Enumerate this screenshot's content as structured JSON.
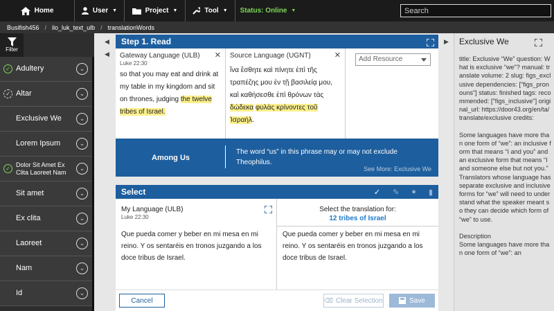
{
  "topbar": {
    "home": "Home",
    "user": "User",
    "project": "Project",
    "tool": "Tool",
    "status": "Status: Online",
    "search_placeholder": "Search"
  },
  "breadcrumb": [
    "Busifish456",
    "ilo_luk_text_ulb",
    "translationWords"
  ],
  "sidebar": {
    "filter_label": "Filter",
    "items": [
      {
        "label": "Adultery",
        "state": "checked"
      },
      {
        "label": "Altar",
        "state": "dashed"
      },
      {
        "label": "Exclusive We",
        "state": "none"
      },
      {
        "label": "Lorem Ipsum",
        "state": "none"
      },
      {
        "label": "Dolor Sit Amet Ex Clita Laoreet Nam",
        "state": "checked"
      },
      {
        "label": "Sit amet",
        "state": "none"
      },
      {
        "label": "Ex clita",
        "state": "none"
      },
      {
        "label": "Laoreet",
        "state": "none"
      },
      {
        "label": "Nam",
        "state": "none"
      },
      {
        "label": "Id",
        "state": "none"
      }
    ]
  },
  "step": {
    "title": "Step 1. Read",
    "gateway": {
      "title": "Gateway Language (ULB)",
      "ref": "Luke 22:30",
      "text_before": "so that you may eat and drink at my table in my kingdom and sit on thrones, judging ",
      "text_highlight": "the twelve tribes of Israel."
    },
    "source": {
      "title": "Source Language (UGNT)",
      "text_before": "ἵνα ἔσθητε καὶ πίνητε ἐπὶ τῆς τραπέζης μου ἐν τῇ βασιλείᾳ μου, καὶ καθήσεσθε ἐπὶ θρόνων τὰς ",
      "text_highlight1": "δώδεκα",
      "text_highlight2": "φυλὰς κρίνοντες τοῦ Ἰσραήλ",
      "text_after": "."
    },
    "add_resource": "Add Resource"
  },
  "among": {
    "title": "Among Us",
    "text": "The word “us” in this phrase may or may not exclude Theophilus.",
    "see_more": "See More: Exclusive We"
  },
  "select": {
    "title": "Select",
    "my_lang_title": "My Language (ULB)",
    "my_lang_ref": "Luke 22:30",
    "my_lang_text": "Que pueda comer y beber en mi mesa en mi reino. Y os sentaréis en tronos juzgando a los doce tribus de Israel.",
    "select_for": "Select the translation for:",
    "select_target": "12 tribes of Israel",
    "translation_text": "Que pueda comer y beber en mi mesa en mi reino. Y os sentaréis en tronos juzgando a los doce tribus de Israel.",
    "cancel": "Cancel",
    "clear": "Clear Selection",
    "save": "Save"
  },
  "right_panel": {
    "title": "Exclusive We",
    "meta": "title: Exclusive “We” question: What is exclusive “we”? manual: translate volume: 2 slug: figs_exclusive dependencies: [\"figs_pronouns\"] status: finished tags: recommended: [\"figs_inclusive\"] original_url: https://door43.org/en/ta/ translate/exclusive credits:",
    "para": "Some languages have more than one form of “we”: an inclusive form that means “I and you” and an exclusive form that means “I and someone else but not you.” Translators whose language has separate exclusive and inclusive forms for “we” will need to understand what the speaker meant so they can decide which form of “we” to use.",
    "desc_title": "Description",
    "desc": "Some languages have more than one form of “we”: an"
  },
  "colors": {
    "accent": "#1d5e9e",
    "online": "#7ed957",
    "highlight": "#fbef8c"
  }
}
